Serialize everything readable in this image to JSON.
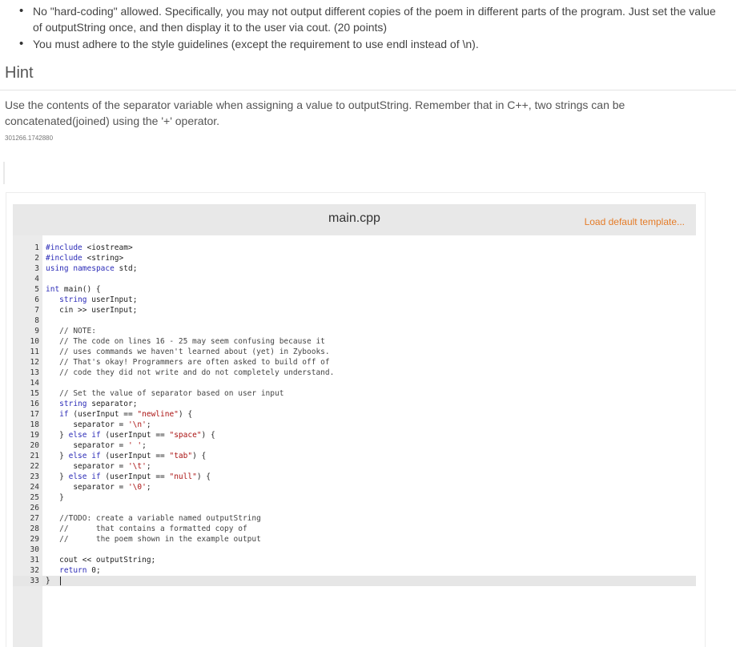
{
  "instructions": {
    "bullets": [
      "No \"hard-coding\" allowed. Specifically, you may not output different copies of the poem in different parts of the program. Just set the value of outputString once, and then display it to the user via cout. (20 points)",
      "You must adhere to the style guidelines (except the requirement to use endl instead of \\n)."
    ]
  },
  "hint": {
    "title": "Hint",
    "text": "Use the contents of the separator variable when assigning a value to outputString. Remember that in C++, two strings can be concatenated(joined) using the '+' operator.",
    "id": "301266.1742880"
  },
  "editor": {
    "filename": "main.cpp",
    "load_template_label": "Load default template...",
    "lines": [
      "#include <iostream>",
      "#include <string>",
      "using namespace std;",
      "",
      "int main() {",
      "   string userInput;",
      "   cin >> userInput;",
      "",
      "   // NOTE:",
      "   // The code on lines 16 - 25 may seem confusing because it",
      "   // uses commands we haven't learned about (yet) in Zybooks.",
      "   // That's okay! Programmers are often asked to build off of",
      "   // code they did not write and do not completely understand.",
      "",
      "   // Set the value of separator based on user input",
      "   string separator;",
      "   if (userInput == \"newline\") {",
      "      separator = '\\n';",
      "   } else if (userInput == \"space\") {",
      "      separator = ' ';",
      "   } else if (userInput == \"tab\") {",
      "      separator = '\\t';",
      "   } else if (userInput == \"null\") {",
      "      separator = '\\0';",
      "   }",
      "",
      "   //TODO: create a variable named outputString",
      "   //      that contains a formatted copy of",
      "   //      the poem shown in the example output",
      "",
      "   cout << outputString;",
      "   return 0;",
      "}"
    ],
    "line_numbers": [
      "1",
      "2",
      "3",
      "4",
      "5",
      "6",
      "7",
      "8",
      "9",
      "10",
      "11",
      "12",
      "13",
      "14",
      "15",
      "16",
      "17",
      "18",
      "19",
      "20",
      "21",
      "22",
      "23",
      "24",
      "25",
      "26",
      "27",
      "28",
      "29",
      "30",
      "31",
      "32",
      "33"
    ],
    "active_line": 33
  }
}
